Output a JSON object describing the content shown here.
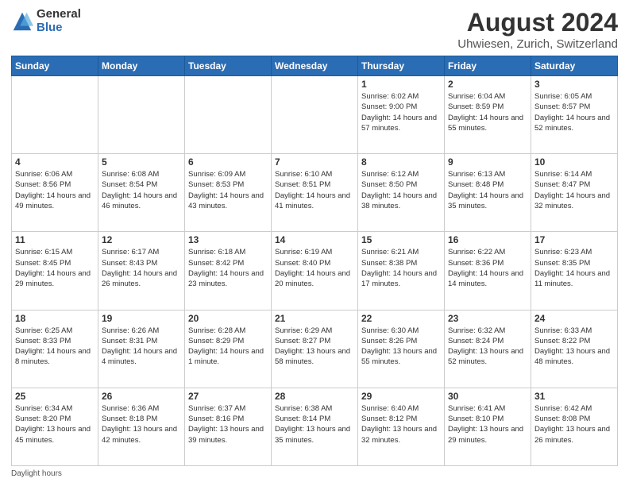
{
  "logo": {
    "general": "General",
    "blue": "Blue"
  },
  "title": {
    "month_year": "August 2024",
    "location": "Uhwiesen, Zurich, Switzerland"
  },
  "weekdays": [
    "Sunday",
    "Monday",
    "Tuesday",
    "Wednesday",
    "Thursday",
    "Friday",
    "Saturday"
  ],
  "weeks": [
    [
      {
        "day": "",
        "info": ""
      },
      {
        "day": "",
        "info": ""
      },
      {
        "day": "",
        "info": ""
      },
      {
        "day": "",
        "info": ""
      },
      {
        "day": "1",
        "info": "Sunrise: 6:02 AM\nSunset: 9:00 PM\nDaylight: 14 hours and 57 minutes."
      },
      {
        "day": "2",
        "info": "Sunrise: 6:04 AM\nSunset: 8:59 PM\nDaylight: 14 hours and 55 minutes."
      },
      {
        "day": "3",
        "info": "Sunrise: 6:05 AM\nSunset: 8:57 PM\nDaylight: 14 hours and 52 minutes."
      }
    ],
    [
      {
        "day": "4",
        "info": "Sunrise: 6:06 AM\nSunset: 8:56 PM\nDaylight: 14 hours and 49 minutes."
      },
      {
        "day": "5",
        "info": "Sunrise: 6:08 AM\nSunset: 8:54 PM\nDaylight: 14 hours and 46 minutes."
      },
      {
        "day": "6",
        "info": "Sunrise: 6:09 AM\nSunset: 8:53 PM\nDaylight: 14 hours and 43 minutes."
      },
      {
        "day": "7",
        "info": "Sunrise: 6:10 AM\nSunset: 8:51 PM\nDaylight: 14 hours and 41 minutes."
      },
      {
        "day": "8",
        "info": "Sunrise: 6:12 AM\nSunset: 8:50 PM\nDaylight: 14 hours and 38 minutes."
      },
      {
        "day": "9",
        "info": "Sunrise: 6:13 AM\nSunset: 8:48 PM\nDaylight: 14 hours and 35 minutes."
      },
      {
        "day": "10",
        "info": "Sunrise: 6:14 AM\nSunset: 8:47 PM\nDaylight: 14 hours and 32 minutes."
      }
    ],
    [
      {
        "day": "11",
        "info": "Sunrise: 6:15 AM\nSunset: 8:45 PM\nDaylight: 14 hours and 29 minutes."
      },
      {
        "day": "12",
        "info": "Sunrise: 6:17 AM\nSunset: 8:43 PM\nDaylight: 14 hours and 26 minutes."
      },
      {
        "day": "13",
        "info": "Sunrise: 6:18 AM\nSunset: 8:42 PM\nDaylight: 14 hours and 23 minutes."
      },
      {
        "day": "14",
        "info": "Sunrise: 6:19 AM\nSunset: 8:40 PM\nDaylight: 14 hours and 20 minutes."
      },
      {
        "day": "15",
        "info": "Sunrise: 6:21 AM\nSunset: 8:38 PM\nDaylight: 14 hours and 17 minutes."
      },
      {
        "day": "16",
        "info": "Sunrise: 6:22 AM\nSunset: 8:36 PM\nDaylight: 14 hours and 14 minutes."
      },
      {
        "day": "17",
        "info": "Sunrise: 6:23 AM\nSunset: 8:35 PM\nDaylight: 14 hours and 11 minutes."
      }
    ],
    [
      {
        "day": "18",
        "info": "Sunrise: 6:25 AM\nSunset: 8:33 PM\nDaylight: 14 hours and 8 minutes."
      },
      {
        "day": "19",
        "info": "Sunrise: 6:26 AM\nSunset: 8:31 PM\nDaylight: 14 hours and 4 minutes."
      },
      {
        "day": "20",
        "info": "Sunrise: 6:28 AM\nSunset: 8:29 PM\nDaylight: 14 hours and 1 minute."
      },
      {
        "day": "21",
        "info": "Sunrise: 6:29 AM\nSunset: 8:27 PM\nDaylight: 13 hours and 58 minutes."
      },
      {
        "day": "22",
        "info": "Sunrise: 6:30 AM\nSunset: 8:26 PM\nDaylight: 13 hours and 55 minutes."
      },
      {
        "day": "23",
        "info": "Sunrise: 6:32 AM\nSunset: 8:24 PM\nDaylight: 13 hours and 52 minutes."
      },
      {
        "day": "24",
        "info": "Sunrise: 6:33 AM\nSunset: 8:22 PM\nDaylight: 13 hours and 48 minutes."
      }
    ],
    [
      {
        "day": "25",
        "info": "Sunrise: 6:34 AM\nSunset: 8:20 PM\nDaylight: 13 hours and 45 minutes."
      },
      {
        "day": "26",
        "info": "Sunrise: 6:36 AM\nSunset: 8:18 PM\nDaylight: 13 hours and 42 minutes."
      },
      {
        "day": "27",
        "info": "Sunrise: 6:37 AM\nSunset: 8:16 PM\nDaylight: 13 hours and 39 minutes."
      },
      {
        "day": "28",
        "info": "Sunrise: 6:38 AM\nSunset: 8:14 PM\nDaylight: 13 hours and 35 minutes."
      },
      {
        "day": "29",
        "info": "Sunrise: 6:40 AM\nSunset: 8:12 PM\nDaylight: 13 hours and 32 minutes."
      },
      {
        "day": "30",
        "info": "Sunrise: 6:41 AM\nSunset: 8:10 PM\nDaylight: 13 hours and 29 minutes."
      },
      {
        "day": "31",
        "info": "Sunrise: 6:42 AM\nSunset: 8:08 PM\nDaylight: 13 hours and 26 minutes."
      }
    ]
  ],
  "footer": {
    "note": "Daylight hours"
  }
}
